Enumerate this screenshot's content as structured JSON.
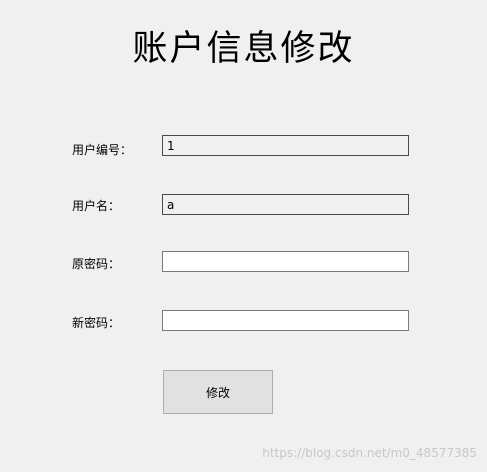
{
  "window": {
    "title": "账户信息修改"
  },
  "form": {
    "fields": [
      {
        "label": "用户编号：",
        "value": "1",
        "placeholder": ""
      },
      {
        "label": "用户名：",
        "value": "a",
        "placeholder": ""
      },
      {
        "label": "原密码：",
        "value": "",
        "placeholder": ""
      },
      {
        "label": "新密码：",
        "value": "",
        "placeholder": ""
      }
    ],
    "submit_label": "修改"
  },
  "watermark": "https://blog.csdn.net/m0_48577385"
}
